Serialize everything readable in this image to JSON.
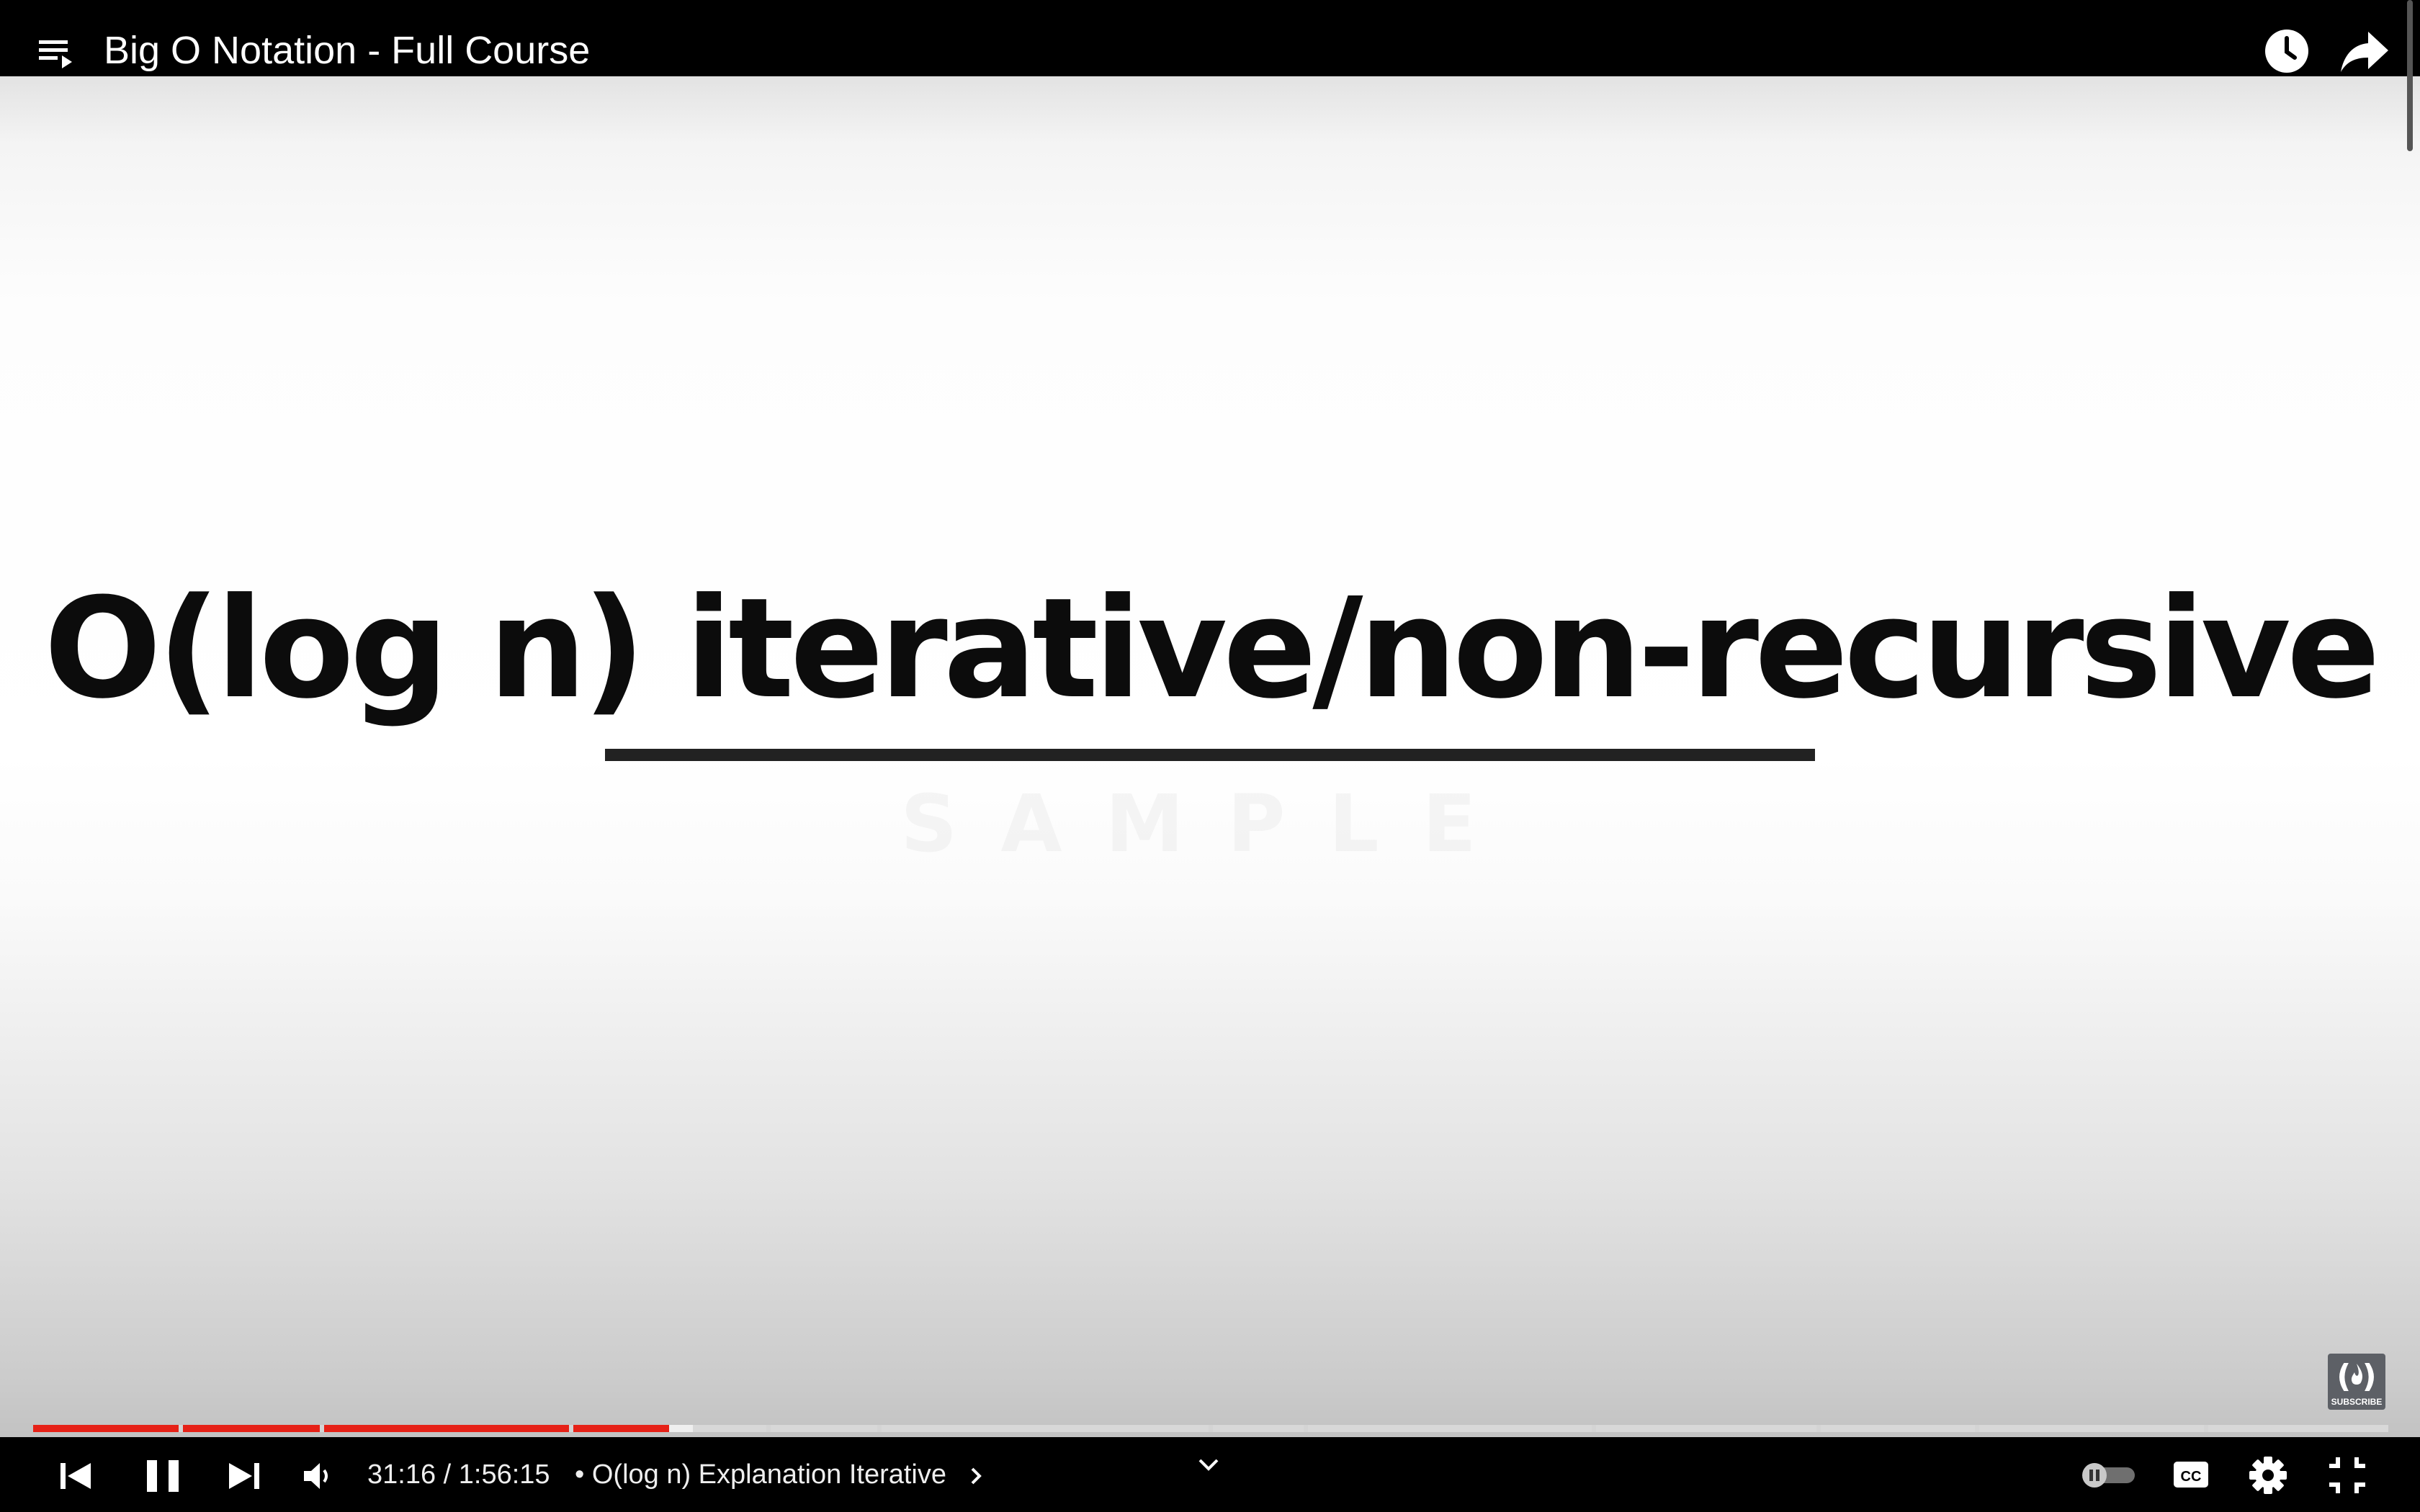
{
  "header": {
    "title": "Big O Notation - Full Course"
  },
  "slide": {
    "text": "O(log n) iterative/non-recursive"
  },
  "controls": {
    "time_current": "31:16",
    "time_separator": " / ",
    "time_total": "1:56:15",
    "chapter_label": "• O(log n) Explanation Iterative",
    "progress_played_fraction": 0.27,
    "progress_buffered_fraction": 0.28
  },
  "branding": {
    "text": "SUBSCRIBE"
  },
  "icons": {
    "playlist": "playlist-icon",
    "watch_later": "clock-icon",
    "share": "share-arrow-icon",
    "prev": "skip-previous-icon",
    "pause": "pause-icon",
    "next": "skip-next-icon",
    "volume": "volume-icon",
    "chapter_chevron": "chevron-right-icon",
    "expand": "chevron-down-icon",
    "autoplay": "autoplay-toggle-icon",
    "cc": "closed-captions-icon",
    "settings": "gear-icon",
    "exit_fullscreen": "exit-fullscreen-icon"
  },
  "colors": {
    "progress_played": "#e62117",
    "bar_background": "#000000"
  }
}
